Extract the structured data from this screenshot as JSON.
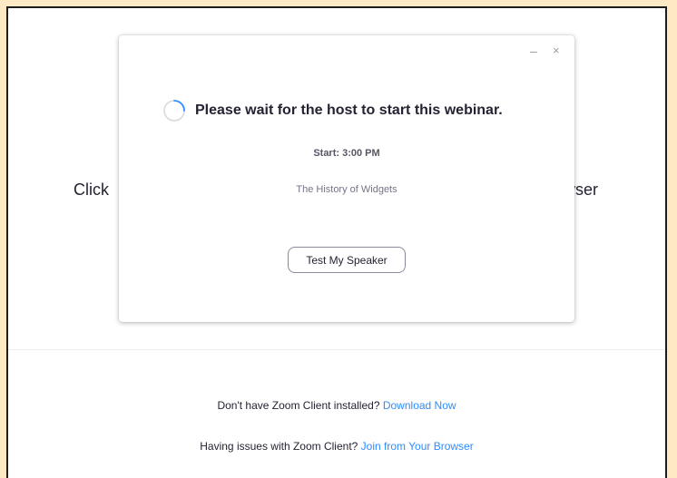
{
  "background": {
    "left_text": "Click",
    "right_text": "wser"
  },
  "dialog": {
    "minimize_symbol": "–",
    "close_symbol": "×",
    "title": "Please wait for the host to start this webinar.",
    "start_time": "Start: 3:00 PM",
    "topic": "The History of Widgets",
    "test_speaker_label": "Test My Speaker",
    "spinner_icon": "loading-spinner-icon"
  },
  "footer": {
    "download_prompt": "Don't have Zoom Client installed?",
    "download_link": "Download Now",
    "browser_prompt": "Having issues with Zoom Client?",
    "browser_link": "Join from Your Browser"
  },
  "colors": {
    "frame_background": "#fde9c3",
    "link": "#2d8cff",
    "text": "#232333"
  }
}
